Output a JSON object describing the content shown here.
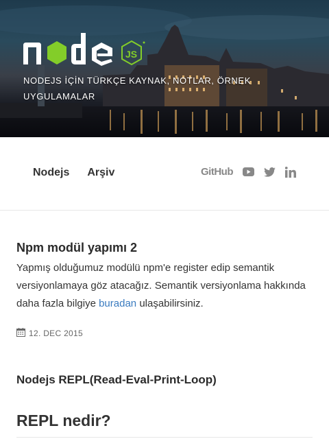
{
  "site": {
    "logo_alt": "node.js",
    "tagline": "NODEJS İÇİN TÜRKÇE KAYNAK, NOTLAR, ÖRNEK UYGULAMALAR"
  },
  "nav": {
    "links": [
      {
        "label": "Nodejs"
      },
      {
        "label": "Arşiv"
      }
    ],
    "social": {
      "github_label": "GitHub",
      "icons": [
        "youtube-icon",
        "twitter-icon",
        "linkedin-icon"
      ]
    }
  },
  "posts": [
    {
      "title": "Npm modül yapımı 2",
      "excerpt_before": "Yapmış olduğumuz modülü npm'e register edip semantik versiyonlamaya göz atacağız. Semantik versiyonlama hakkında daha fazla bilgiye ",
      "excerpt_link": "buradan",
      "excerpt_after": " ulaşabilirsiniz.",
      "date": "12. DEC 2015"
    },
    {
      "title": "Nodejs REPL(Read-Eval-Print-Loop)"
    }
  ],
  "article": {
    "heading": "REPL nedir?"
  },
  "colors": {
    "link": "#3a7bbf",
    "node_green": "#83cd29",
    "text": "#333333",
    "icon_grey": "#888888"
  }
}
